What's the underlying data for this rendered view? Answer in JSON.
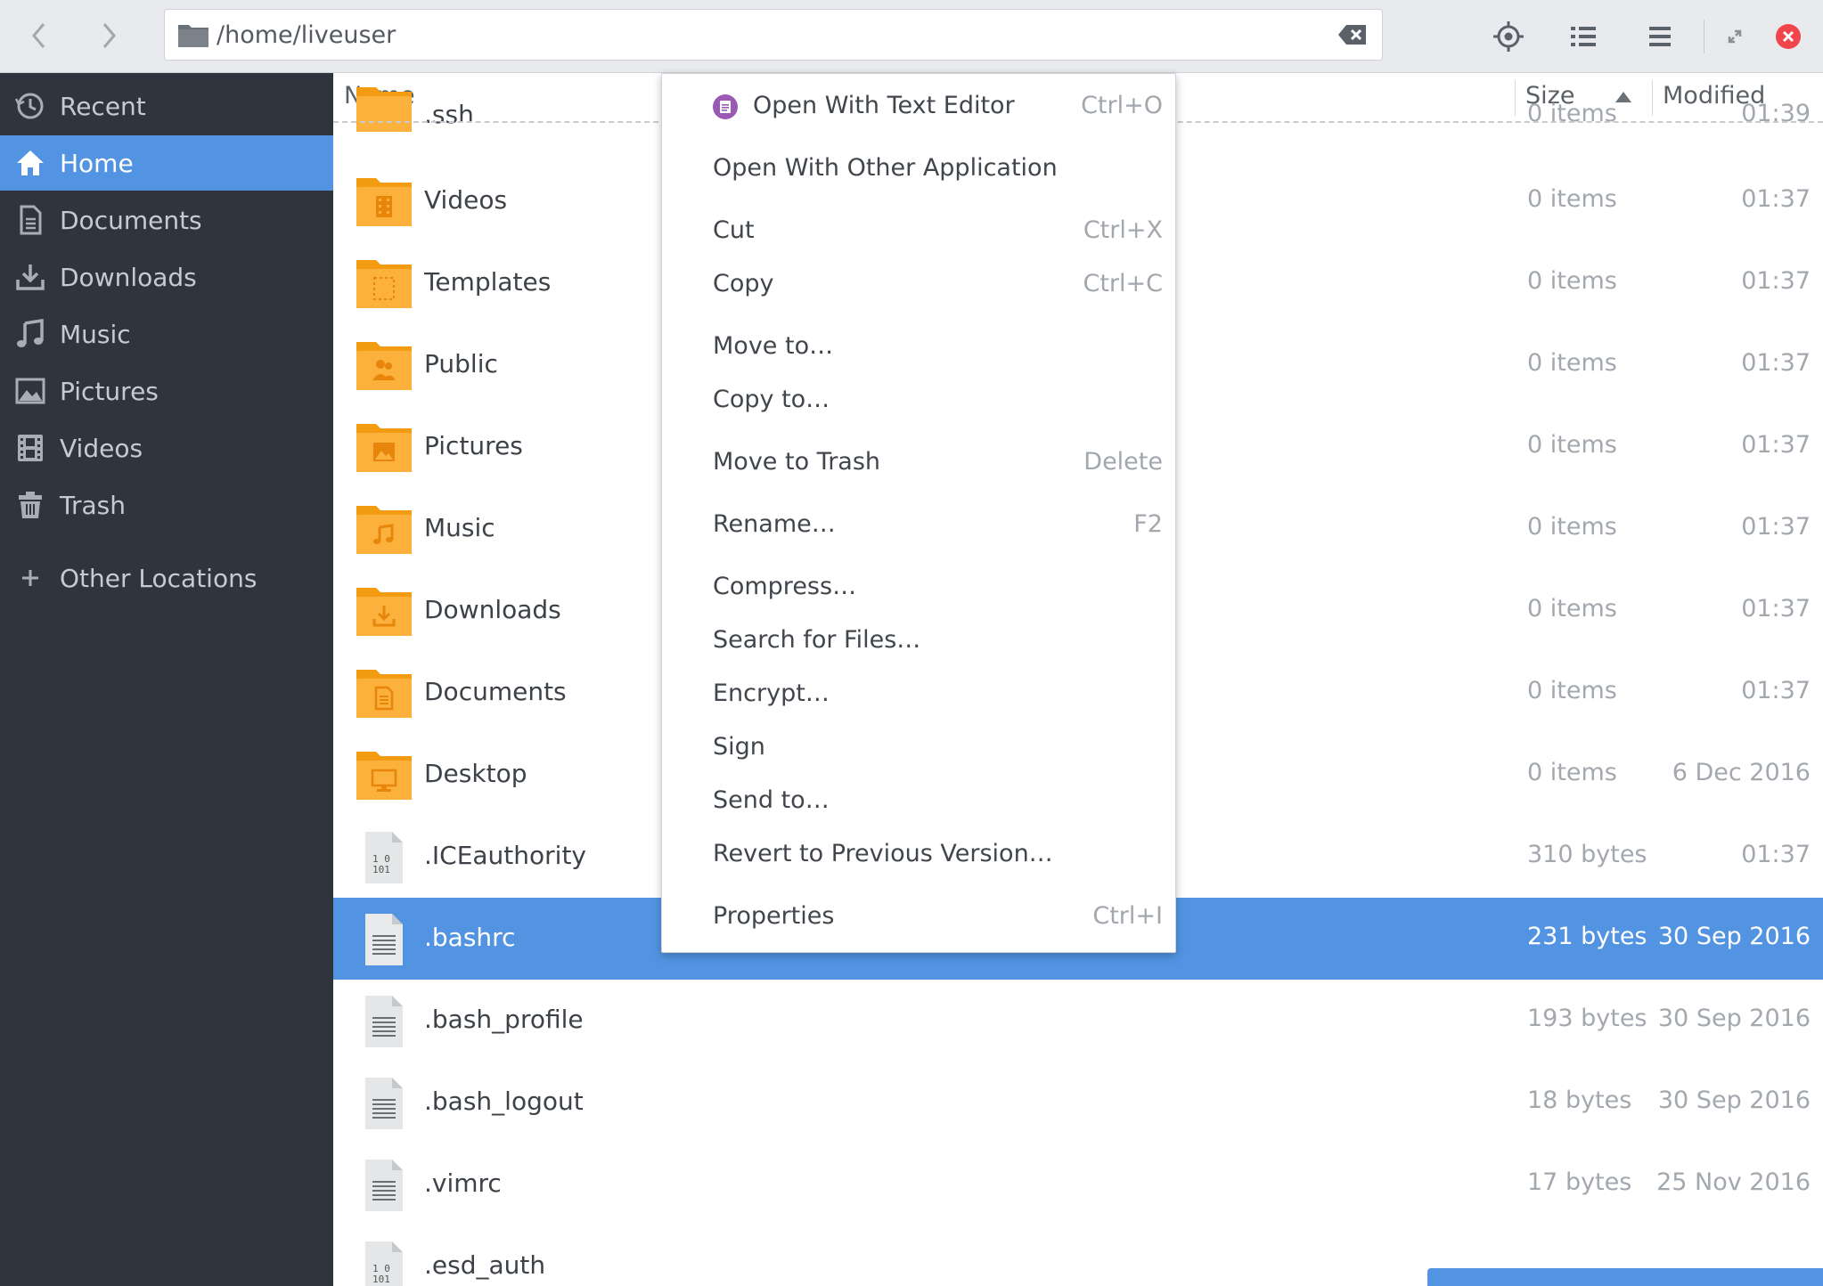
{
  "header": {
    "path": "/home/liveuser",
    "colors": {
      "accent": "#5294e2",
      "close": "#f0454b"
    }
  },
  "sidebar": {
    "items": [
      {
        "label": "Recent",
        "icon": "clock-icon"
      },
      {
        "label": "Home",
        "icon": "home-icon",
        "active": true
      },
      {
        "label": "Documents",
        "icon": "document-icon"
      },
      {
        "label": "Downloads",
        "icon": "download-icon"
      },
      {
        "label": "Music",
        "icon": "music-icon"
      },
      {
        "label": "Pictures",
        "icon": "picture-icon"
      },
      {
        "label": "Videos",
        "icon": "film-icon"
      },
      {
        "label": "Trash",
        "icon": "trash-icon"
      },
      {
        "label": "Other Locations",
        "icon": "plus-icon"
      }
    ]
  },
  "filelist": {
    "columns": {
      "name": "Name",
      "size": "Size",
      "modified": "Modified"
    },
    "rows": [
      {
        "name": ".ssh",
        "size": "0 items",
        "modified": "01:39",
        "icon": "folder-icon"
      },
      {
        "name": "Videos",
        "size": "0 items",
        "modified": "01:37",
        "icon": "folder-videos-icon"
      },
      {
        "name": "Templates",
        "size": "0 items",
        "modified": "01:37",
        "icon": "folder-templates-icon"
      },
      {
        "name": "Public",
        "size": "0 items",
        "modified": "01:37",
        "icon": "folder-public-icon"
      },
      {
        "name": "Pictures",
        "size": "0 items",
        "modified": "01:37",
        "icon": "folder-pictures-icon"
      },
      {
        "name": "Music",
        "size": "0 items",
        "modified": "01:37",
        "icon": "folder-music-icon"
      },
      {
        "name": "Downloads",
        "size": "0 items",
        "modified": "01:37",
        "icon": "folder-downloads-icon"
      },
      {
        "name": "Documents",
        "size": "0 items",
        "modified": "01:37",
        "icon": "folder-documents-icon"
      },
      {
        "name": "Desktop",
        "size": "0 items",
        "modified": "6 Dec 2016",
        "icon": "folder-desktop-icon"
      },
      {
        "name": ".ICEauthority",
        "size": "310 bytes",
        "modified": "01:37",
        "icon": "binary-file-icon"
      },
      {
        "name": ".bashrc",
        "size": "231 bytes",
        "modified": "30 Sep 2016",
        "icon": "text-file-icon",
        "selected": true
      },
      {
        "name": ".bash_profile",
        "size": "193 bytes",
        "modified": "30 Sep 2016",
        "icon": "text-file-icon"
      },
      {
        "name": ".bash_logout",
        "size": "18 bytes",
        "modified": "30 Sep 2016",
        "icon": "text-file-icon"
      },
      {
        "name": ".vimrc",
        "size": "17 bytes",
        "modified": "25 Nov 2016",
        "icon": "text-file-icon"
      },
      {
        "name": ".esd_auth",
        "size": "",
        "modified": "",
        "icon": "binary-file-icon"
      }
    ]
  },
  "context_menu": {
    "items": [
      {
        "label": "Open With Text Editor",
        "accel": "Ctrl+O",
        "icon": "text-editor-app-icon"
      },
      {
        "label": "Open With Other Application",
        "accel": ""
      },
      {
        "label": "Cut",
        "accel": "Ctrl+X"
      },
      {
        "label": "Copy",
        "accel": "Ctrl+C"
      },
      {
        "label": "Move to…",
        "accel": ""
      },
      {
        "label": "Copy to…",
        "accel": ""
      },
      {
        "label": "Move to Trash",
        "accel": "Delete"
      },
      {
        "label": "Rename…",
        "accel": "F2"
      },
      {
        "label": "Compress…",
        "accel": ""
      },
      {
        "label": "Search for Files…",
        "accel": ""
      },
      {
        "label": "Encrypt…",
        "accel": ""
      },
      {
        "label": "Sign",
        "accel": ""
      },
      {
        "label": "Send to…",
        "accel": ""
      },
      {
        "label": "Revert to Previous Version…",
        "accel": ""
      },
      {
        "label": "Properties",
        "accel": "Ctrl+I"
      }
    ]
  }
}
